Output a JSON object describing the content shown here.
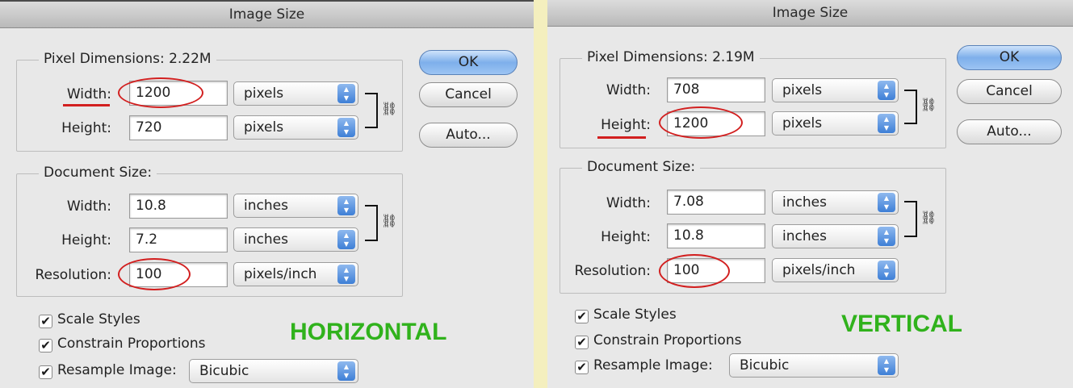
{
  "left": {
    "title": "Image Size",
    "pixel_dimensions": {
      "legend": "Pixel Dimensions:  2.22M",
      "width_label": "Width:",
      "width_value": "1200",
      "height_label": "Height:",
      "height_value": "720",
      "width_unit": "pixels",
      "height_unit": "pixels"
    },
    "document_size": {
      "legend": "Document Size:",
      "width_label": "Width:",
      "width_value": "10.8",
      "height_label": "Height:",
      "height_value": "7.2",
      "resolution_label": "Resolution:",
      "resolution_value": "100",
      "width_unit": "inches",
      "height_unit": "inches",
      "resolution_unit": "pixels/inch"
    },
    "buttons": {
      "ok": "OK",
      "cancel": "Cancel",
      "auto": "Auto..."
    },
    "options": {
      "scale_styles": "Scale Styles",
      "constrain": "Constrain Proportions",
      "resample": "Resample Image:",
      "resample_method": "Bicubic"
    },
    "annotation": "HORIZONTAL"
  },
  "right": {
    "title": "Image Size",
    "pixel_dimensions": {
      "legend": "Pixel Dimensions:  2.19M",
      "width_label": "Width:",
      "width_value": "708",
      "height_label": "Height:",
      "height_value": "1200",
      "width_unit": "pixels",
      "height_unit": "pixels"
    },
    "document_size": {
      "legend": "Document Size:",
      "width_label": "Width:",
      "width_value": "7.08",
      "height_label": "Height:",
      "height_value": "10.8",
      "resolution_label": "Resolution:",
      "resolution_value": "100",
      "width_unit": "inches",
      "height_unit": "inches",
      "resolution_unit": "pixels/inch"
    },
    "buttons": {
      "ok": "OK",
      "cancel": "Cancel",
      "auto": "Auto..."
    },
    "options": {
      "scale_styles": "Scale Styles",
      "constrain": "Constrain Proportions",
      "resample": "Resample Image:",
      "resample_method": "Bicubic"
    },
    "annotation": "VERTICAL"
  },
  "icons": {
    "checkmark": "✔",
    "chain_link": "chain-link-icon",
    "select_arrows": "up-down-arrows-icon"
  },
  "colors": {
    "annotation_red": "#d21f1f",
    "annotation_green": "#30b21c",
    "ok_button_blue": "#7eafeb"
  }
}
